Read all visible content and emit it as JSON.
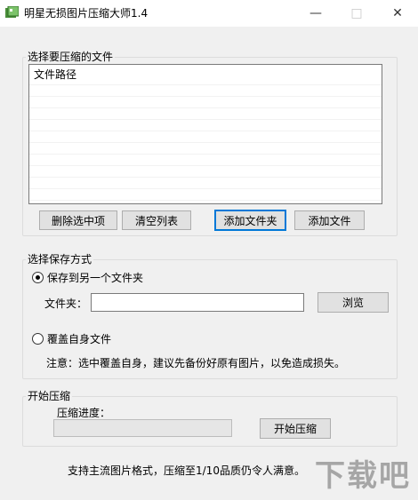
{
  "window": {
    "title": "明星无损图片压缩大师1.4",
    "minimize_icon": "minimize-icon",
    "maximize_icon": "maximize-icon",
    "close_icon": "close-icon"
  },
  "files_group": {
    "label": "选择要压缩的文件",
    "list_header": "文件路径",
    "buttons": {
      "delete_selected": "删除选中项",
      "clear_list": "清空列表",
      "add_folder": "添加文件夹",
      "add_files": "添加文件"
    }
  },
  "save_group": {
    "label": "选择保存方式",
    "option_other_folder": "保存到另一个文件夹",
    "option_other_folder_selected": true,
    "folder_label": "文件夹：",
    "folder_value": "",
    "browse_button": "浏览",
    "option_overwrite": "覆盖自身文件",
    "option_overwrite_selected": false,
    "note": "注意：选中覆盖自身，建议先备份好原有图片，以免造成损失。"
  },
  "compress_group": {
    "label": "开始压缩",
    "progress_label": "压缩进度：",
    "progress_value": 0,
    "start_button": "开始压缩"
  },
  "footer": {
    "tagline": "支持主流图片格式，压缩至1/10品质仍令人满意。"
  },
  "watermark": {
    "text": "下载吧"
  }
}
